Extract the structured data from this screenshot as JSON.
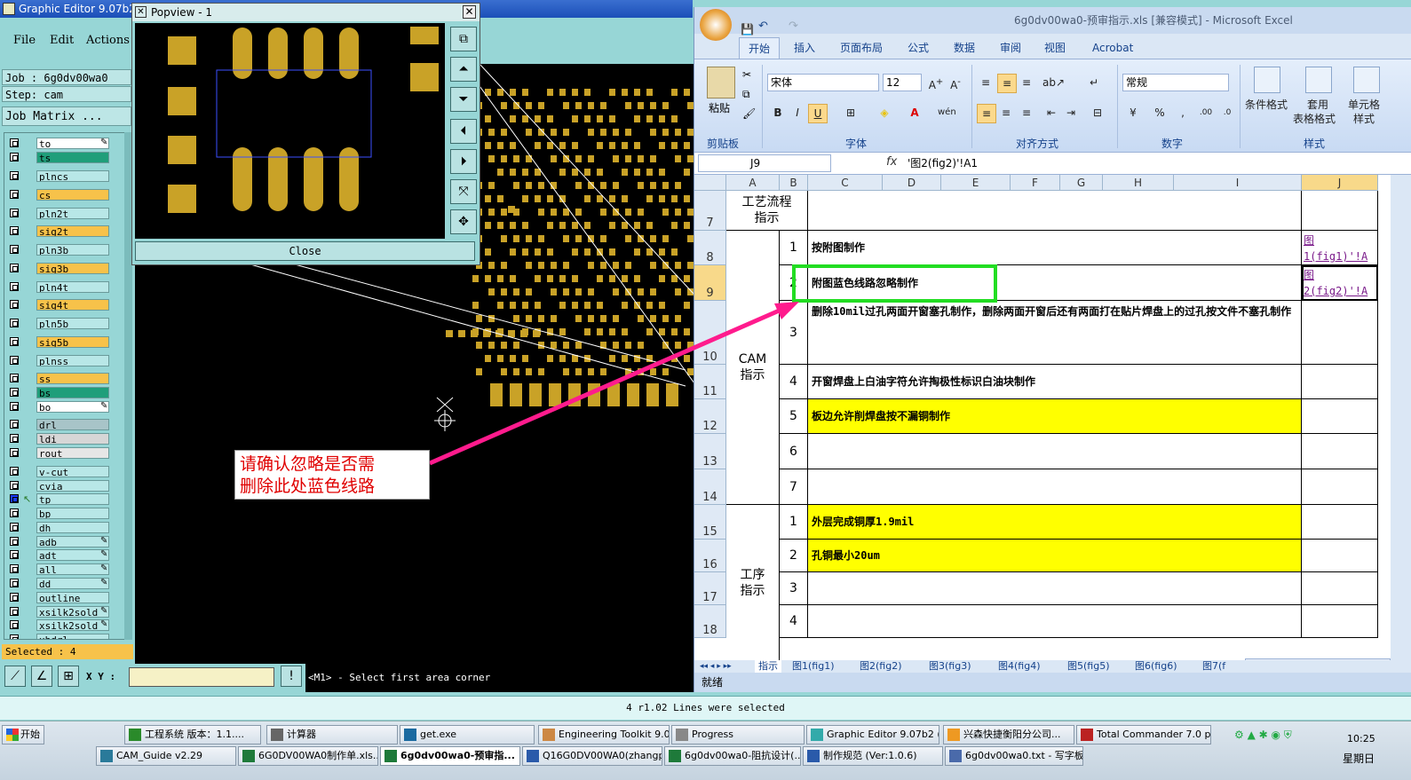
{
  "graphic_editor": {
    "title": "Graphic Editor 9.07b2 (",
    "menu": [
      "File",
      "Edit",
      "Actions"
    ],
    "job_label": "Job : 6g0dv00wa0",
    "step_label": "Step: cam",
    "job_matrix_button": "Job Matrix ...",
    "layers": [
      {
        "name": "to",
        "color": "#ffffff",
        "icon": "edit-icon"
      },
      {
        "name": "ts",
        "color": "#1f9e7a"
      },
      {
        "name": "plncs",
        "color": "#b8e7e7"
      },
      {
        "name": "cs",
        "color": "#f7c24a"
      },
      {
        "name": "pln2t",
        "color": "#b8e7e7"
      },
      {
        "name": "sig2t",
        "color": "#f7c24a"
      },
      {
        "name": "pln3b",
        "color": "#b8e7e7"
      },
      {
        "name": "sig3b",
        "color": "#f7c24a"
      },
      {
        "name": "pln4t",
        "color": "#b8e7e7"
      },
      {
        "name": "sig4t",
        "color": "#f7c24a"
      },
      {
        "name": "pln5b",
        "color": "#b8e7e7"
      },
      {
        "name": "sig5b",
        "color": "#f7c24a"
      },
      {
        "name": "plnss",
        "color": "#b8e7e7"
      },
      {
        "name": "ss",
        "color": "#f7c24a"
      },
      {
        "name": "bs",
        "color": "#1f9e7a"
      },
      {
        "name": "bo",
        "color": "#ffffff",
        "icon": "edit-icon"
      },
      {
        "name": "drl",
        "color": "#a8c4c8"
      },
      {
        "name": "ldi",
        "color": "#d6d6d6"
      },
      {
        "name": "rout",
        "color": "#e6e6e6"
      },
      {
        "name": "v-cut",
        "color": "#b8e7e7"
      },
      {
        "name": "cvia",
        "color": "#b8e7e7"
      },
      {
        "name": "tp",
        "color": "#b8e7e7",
        "active": true
      },
      {
        "name": "bp",
        "color": "#b8e7e7"
      },
      {
        "name": "dh",
        "color": "#b8e7e7"
      },
      {
        "name": "adb",
        "color": "#b8e7e7",
        "icon": "edit-icon"
      },
      {
        "name": "adt",
        "color": "#b8e7e7",
        "icon": "edit-icon"
      },
      {
        "name": "all",
        "color": "#b8e7e7",
        "icon": "edit-icon"
      },
      {
        "name": "dd",
        "color": "#b8e7e7",
        "icon": "edit-icon"
      },
      {
        "name": "outline",
        "color": "#b8e7e7"
      },
      {
        "name": "xsilk2sold",
        "color": "#b8e7e7",
        "icon": "edit-icon"
      },
      {
        "name": "xsilk2sold",
        "color": "#b8e7e7",
        "icon": "edit-icon"
      },
      {
        "name": "xhdrl",
        "color": "#b8e7e7"
      }
    ],
    "selected": "Selected : 4",
    "xy_label": "X Y :",
    "xy_value": "",
    "prompt": "<M1> - Select first area corner",
    "status": "4 r1.02 Lines were selected"
  },
  "popview": {
    "title": "Popview - 1",
    "close_button": "Close",
    "close_icon": "x-icon"
  },
  "annotation": {
    "line1": "请确认忽略是否需",
    "line2": "删除此处蓝色线路"
  },
  "excel": {
    "title": "6g0dv00wa0-预审指示.xls  [兼容模式] - Microsoft Excel",
    "tabs": [
      "开始",
      "插入",
      "页面布局",
      "公式",
      "数据",
      "审阅",
      "视图",
      "Acrobat"
    ],
    "ribbon": {
      "paste": "粘贴",
      "clipboard": "剪贴板",
      "font_name": "宋体",
      "font_size": "12",
      "font_group": "字体",
      "align_group": "对齐方式",
      "number_format": "常规",
      "number_group": "数字",
      "cond_format": "条件格式",
      "table_format_1": "套用",
      "table_format_2": "表格格式",
      "cell_style_1": "单元格",
      "cell_style_2": "样式",
      "style_group": "样式"
    },
    "name_box": "J9",
    "formula": "'图2(fig2)'!A1",
    "columns": [
      "A",
      "B",
      "C",
      "D",
      "E",
      "F",
      "G",
      "H",
      "I",
      "J"
    ],
    "rows": [
      {
        "n": "7",
        "a": "工艺流程\n指示"
      },
      {
        "n": "8",
        "b": "1",
        "c": "按附图制作",
        "j": "图\n1(fig1)'!A"
      },
      {
        "n": "9",
        "b": "2",
        "c": "附图蓝色线路忽略制作",
        "j": "图\n2(fig2)'!A"
      },
      {
        "n": "10",
        "b": "3",
        "c": "删除10mil过孔两面开窗塞孔制作，删除两面开窗后还有两面打在贴片焊盘上的过孔按文件不塞孔制作"
      },
      {
        "n": "11",
        "b": "4",
        "c": "开窗焊盘上白油字符允许掏极性标识白油块制作"
      },
      {
        "n": "12",
        "b": "5",
        "c": "板边允许削焊盘按不漏铜制作",
        "yellow": true
      },
      {
        "n": "13",
        "b": "6",
        "c": ""
      },
      {
        "n": "14",
        "b": "7",
        "c": ""
      },
      {
        "n": "15",
        "b": "1",
        "c": "外层完成铜厚1.9mil",
        "yellow": true
      },
      {
        "n": "16",
        "b": "2",
        "c": "孔铜最小20um",
        "yellow": true
      },
      {
        "n": "17",
        "b": "3",
        "c": ""
      },
      {
        "n": "18",
        "b": "4",
        "c": ""
      }
    ],
    "merged_cam": "CAM\n指示",
    "merged_process": "工序\n指示",
    "sheet_tabs": [
      "指示",
      "图1(fig1)",
      "图2(fig2)",
      "图3(fig3)",
      "图4(fig4)",
      "图5(fig5)",
      "图6(fig6)",
      "图7(f"
    ],
    "status": "就绪"
  },
  "taskbar": {
    "start": "开始",
    "row1": [
      "工程系统  版本：1.1....",
      "计算器",
      "get.exe",
      "Engineering Toolkit 9.0...",
      "Progress",
      "Graphic Editor 9.07b2 (...",
      "兴森快捷衡阳分公司...",
      "Total Commander 7.0 p..."
    ],
    "row2": [
      "CAM_Guide v2.29",
      "6G0DV00WA0制作单.xls...",
      "6g0dv00wa0-预审指...",
      "Q16G0DV00WA0(zhangp...",
      "6g0dv00wa0-阻抗设计(...",
      "制作规范 (Ver:1.0.6)",
      "6g0dv00wa0.txt - 写字板"
    ],
    "time": "10:25",
    "day": "星期日"
  }
}
